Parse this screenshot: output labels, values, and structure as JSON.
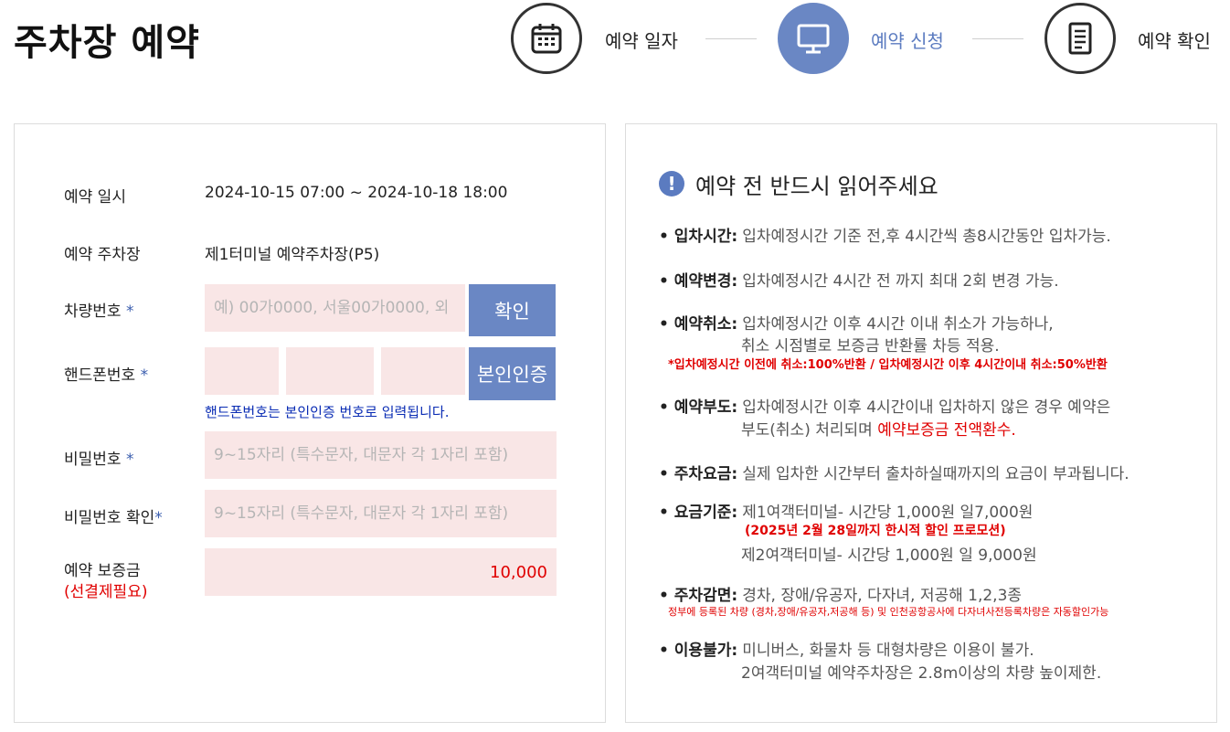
{
  "page": {
    "title": "주차장 예약"
  },
  "steps": [
    {
      "label": "예약 일자",
      "icon": "calendar-icon",
      "state": "done"
    },
    {
      "label": "예약 신청",
      "icon": "monitor-icon",
      "state": "active"
    },
    {
      "label": "예약 확인",
      "icon": "document-icon",
      "state": "pending"
    }
  ],
  "colors": {
    "accent": "#6a87c4",
    "input_bg": "#f9e6e6",
    "warning": "#e00000"
  },
  "form": {
    "datetime": {
      "label": "예약 일시",
      "value": "2024-10-15 07:00 ~ 2024-10-18 18:00"
    },
    "lot": {
      "label": "예약 주차장",
      "value": "제1터미널 예약주차장(P5)"
    },
    "car": {
      "label": "차량번호",
      "required": "*",
      "placeholder": "예) 00가0000, 서울00가0000, 외",
      "button": "확인"
    },
    "phone": {
      "label": "핸드폰번호",
      "required": "*",
      "button": "본인인증",
      "help": "핸드폰번호는 본인인증 번호로 입력됩니다."
    },
    "password": {
      "label": "비밀번호",
      "required": "*",
      "placeholder": "9~15자리 (특수문자, 대문자 각 1자리 포함)"
    },
    "password_confirm": {
      "label": "비밀번호 확인",
      "required": "*",
      "placeholder": "9~15자리 (특수문자, 대문자 각 1자리 포함)"
    },
    "deposit": {
      "label": "예약 보증금",
      "note": "(선결제필요)",
      "value": "10,000"
    }
  },
  "notice": {
    "title": "예약 전 반드시 읽어주세요",
    "items": [
      {
        "label": "입차시간",
        "lines": [
          "입차예정시간 기준 전,후 4시간씩 총8시간동안 입차가능."
        ]
      },
      {
        "label": "예약변경",
        "lines": [
          "입차예정시간 4시간 전 까지 최대 2회 변경 가능."
        ]
      },
      {
        "label": "예약취소",
        "lines": [
          "입차예정시간 이후 4시간 이내 취소가 가능하나,",
          "취소 시점별로 보증금 반환률 차등 적용."
        ],
        "red": "*입차예정시간 이전에 취소:100%반환 / 입차예정시간 이후 4시간이내 취소:50%반환"
      },
      {
        "label": "예약부도",
        "lines": [
          "입차예정시간 이후 4시간이내 입차하지 않은 경우 예약은",
          "부도(취소) 처리되며 "
        ],
        "red_inline": "예약보증금 전액환수."
      },
      {
        "label": "주차요금",
        "lines": [
          "실제 입차한 시간부터 출차하실때까지의 요금이 부과됩니다."
        ]
      },
      {
        "label": "요금기준",
        "lines": [
          "제1여객터미널- 시간당 1,000원 일7,000원",
          "제2여객터미널- 시간당 1,000원 일 9,000원"
        ],
        "red": "(2025년 2월 28일까지 한시적 할인 프로모션)"
      },
      {
        "label": "주차감면",
        "lines": [
          "경차, 장애/유공자, 다자녀, 저공해 1,2,3종"
        ],
        "red": "정부에 등록된 차량 (경차,장애/유공자,저공해 등) 및 인천공항공사에 다자녀사전등록차량은 자동할인가능"
      },
      {
        "label": "이용불가",
        "lines": [
          "미니버스, 화물차 등 대형차량은 이용이 불가.",
          "2여객터미널 예약주차장은 2.8m이상의 차량 높이제한."
        ]
      }
    ]
  }
}
